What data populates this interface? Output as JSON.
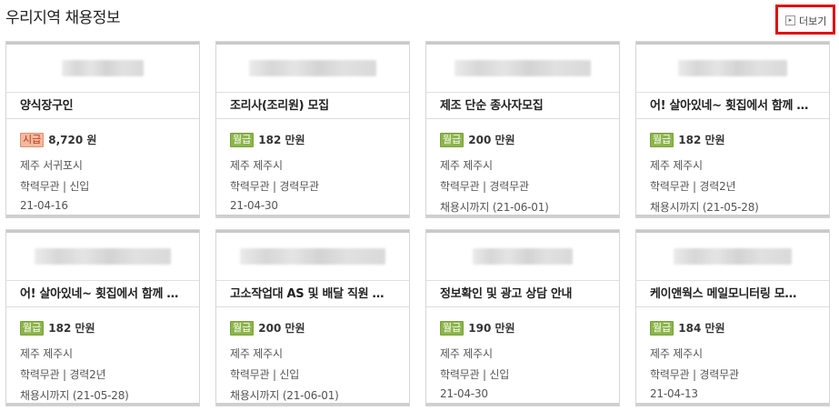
{
  "section": {
    "title": "우리지역 채용정보",
    "more_label": "더보기"
  },
  "jobs": [
    {
      "name": "양식장구인",
      "pay_type": "시급",
      "pay": "8,720 원",
      "location": "제주 서귀포시",
      "condition": "학력무관 | 신입",
      "date": "21-04-16",
      "badge_kind": "hourly"
    },
    {
      "name": "조리사(조리원) 모집",
      "pay_type": "월급",
      "pay": "182 만원",
      "location": "제주 제주시",
      "condition": "학력무관 | 경력무관",
      "date": "21-04-30",
      "badge_kind": "monthly"
    },
    {
      "name": "제조 단순 종사자모집",
      "pay_type": "월급",
      "pay": "200 만원",
      "location": "제주 제주시",
      "condition": "학력무관 | 경력무관",
      "date": "채용시까지 (21-06-01)",
      "badge_kind": "monthly"
    },
    {
      "name": "어! 살아있네~ 횟집에서 함께 …",
      "pay_type": "월급",
      "pay": "182 만원",
      "location": "제주 제주시",
      "condition": "학력무관 | 경력2년",
      "date": "채용시까지 (21-05-28)",
      "badge_kind": "monthly"
    },
    {
      "name": "어! 살아있네~ 횟집에서 함께 …",
      "pay_type": "월급",
      "pay": "182 만원",
      "location": "제주 제주시",
      "condition": "학력무관 | 경력2년",
      "date": "채용시까지 (21-05-28)",
      "badge_kind": "monthly"
    },
    {
      "name": "고소작업대 AS 및 배달 직원 …",
      "pay_type": "월급",
      "pay": "200 만원",
      "location": "제주 제주시",
      "condition": "학력무관 | 신입",
      "date": "채용시까지 (21-06-01)",
      "badge_kind": "monthly"
    },
    {
      "name": "정보확인 및 광고 상담 안내",
      "pay_type": "월급",
      "pay": "190 만원",
      "location": "제주 제주시",
      "condition": "학력무관 | 신입",
      "date": "21-04-30",
      "badge_kind": "monthly"
    },
    {
      "name": "케이앤웍스 메일모니터링 모…",
      "pay_type": "월급",
      "pay": "184 만원",
      "location": "제주 제주시",
      "condition": "학력무관 | 경력무관",
      "date": "21-04-13",
      "badge_kind": "monthly"
    }
  ]
}
